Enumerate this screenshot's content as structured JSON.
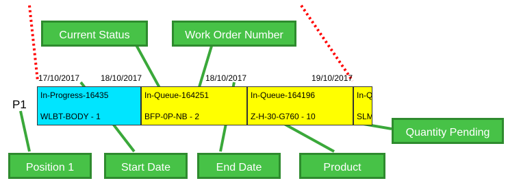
{
  "row_label": "P1",
  "dates": [
    "17/10/2017",
    "18/10/2017",
    "18/10/2017",
    "19/10/2017"
  ],
  "cells": [
    {
      "status": "In-Progress-16435",
      "product_qty": "WLBT-BODY - 1",
      "color": "#00e5ff"
    },
    {
      "status": "In-Queue-164251",
      "product_qty": "BFP-0P-NB - 2",
      "color": "#ffff00"
    },
    {
      "status": "In-Queue-164196",
      "product_qty": "Z-H-30-G760 - 10",
      "color": "#ffff00"
    },
    {
      "status": "In-Q",
      "product_qty": "SLM",
      "color": "#ffff00"
    }
  ],
  "callouts": {
    "current_status": "Current Status",
    "work_order_number": "Work Order Number",
    "quantity_pending": "Quantity Pending",
    "position_1": "Position 1",
    "start_date": "Start Date",
    "end_date": "End Date",
    "product": "Product"
  },
  "colors": {
    "callout_fill": "#47c247",
    "callout_border": "#2e8b2e",
    "connector": "#3aa83a",
    "dotted_marker": "#ff0000"
  }
}
